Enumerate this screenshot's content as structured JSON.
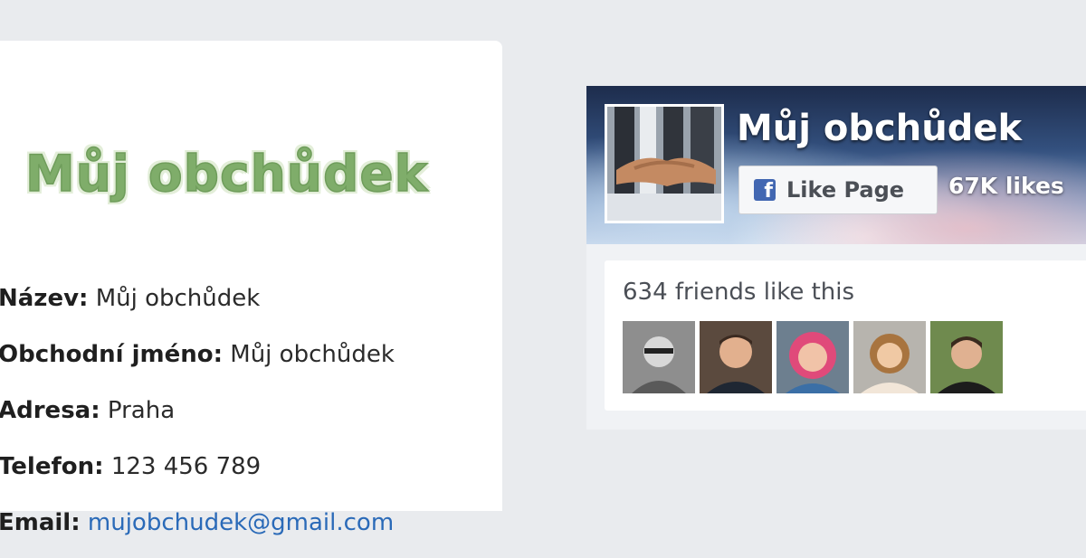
{
  "shop": {
    "logo_text": "Můj obchůdek"
  },
  "details": [
    {
      "label": "Název:",
      "value": "Můj obchůdek"
    },
    {
      "label": "Obchodní jméno:",
      "value": "Můj obchůdek"
    },
    {
      "label": "Adresa:",
      "value": "Praha"
    },
    {
      "label": "Telefon:",
      "value": "123 456 789"
    },
    {
      "label": "Email:",
      "value": "mujobchudek@gmail.com"
    }
  ],
  "facebook": {
    "page_name": "Můj obchůdek",
    "like_label": "Like Page",
    "like_icon": "facebook-f-icon",
    "likes_count": "67K likes",
    "friends_text": "634 friends like this",
    "brand_color": "#4267b2"
  },
  "colors": {
    "logo_green": "#7fad6a",
    "email_link": "#2a6ab8",
    "page_background": "#e9ebee"
  }
}
